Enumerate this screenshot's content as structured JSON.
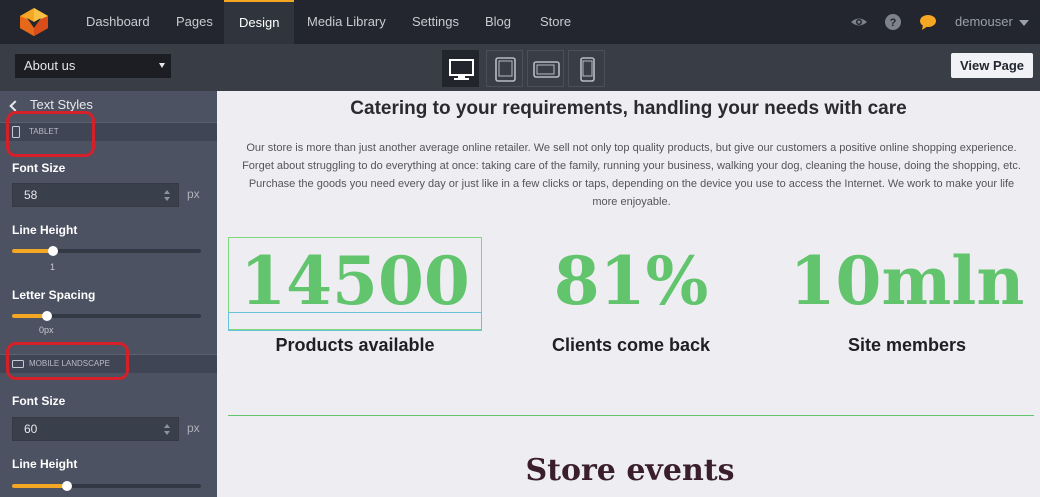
{
  "nav": {
    "items": [
      "Dashboard",
      "Pages",
      "Design",
      "Media Library",
      "Settings",
      "Blog",
      "Store"
    ],
    "active": "Design",
    "user": "demouser"
  },
  "toolbar": {
    "page_select_value": "About us",
    "devices": [
      "desktop-icon",
      "tablet-icon",
      "tablet-landscape-icon",
      "mobile-icon"
    ],
    "active_device": "desktop",
    "view_page_label": "View Page"
  },
  "panel": {
    "back_label": "Text Styles",
    "tablet": {
      "header": "TABLET",
      "font_size_label": "Font Size",
      "font_size_value": "58",
      "font_size_unit": "px",
      "line_height_label": "Line Height",
      "line_height_value": "1",
      "letter_spacing_label": "Letter Spacing",
      "letter_spacing_value": "0px"
    },
    "mobile_landscape": {
      "header": "MOBILE LANDSCAPE",
      "font_size_label": "Font Size",
      "font_size_value": "60",
      "font_size_unit": "px",
      "line_height_label": "Line Height"
    }
  },
  "content": {
    "heading": "Catering to your requirements, handling your needs with care",
    "paragraph": "Our store is more than just another average online retailer. We sell not only top quality products, but give our customers a positive online shopping experience. Forget about struggling to do everything at once: taking care of the family, running your business, walking your dog, cleaning the house, doing the shopping, etc. Purchase the goods you need every day or just like in a few clicks or taps, depending on the device you use to access the Internet. We work to make your life more enjoyable.",
    "stats": [
      {
        "value": "14500",
        "label": "Products available"
      },
      {
        "value": "81%",
        "label": "Clients come back"
      },
      {
        "value": "10mln",
        "label": "Site members"
      }
    ],
    "events_title": "Store events"
  },
  "colors": {
    "accent": "#f5a623",
    "stat_green": "#63c46e",
    "annotation_red": "#d5202a"
  }
}
